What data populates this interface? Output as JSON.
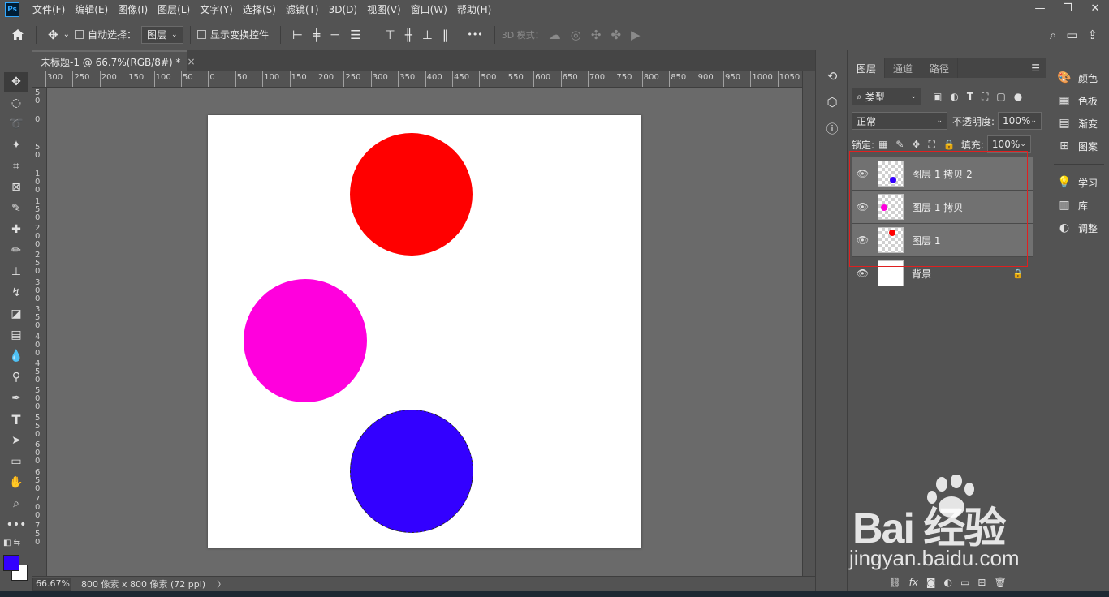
{
  "app": {
    "logo": "Ps",
    "menu": [
      "文件(F)",
      "编辑(E)",
      "图像(I)",
      "图层(L)",
      "文字(Y)",
      "选择(S)",
      "滤镜(T)",
      "3D(D)",
      "视图(V)",
      "窗口(W)",
      "帮助(H)"
    ]
  },
  "options_bar": {
    "auto_select_label": "自动选择：",
    "auto_select_value": "图层",
    "show_transform_label": "显示变换控件",
    "more": "•••",
    "mode_3d_label": "3D 模式："
  },
  "document": {
    "tab_title": "未标题-1 @ 66.7%(RGB/8#) *",
    "close": "×",
    "background": "#ffffff",
    "circles": [
      {
        "name": "red-circle",
        "color": "#ff0000"
      },
      {
        "name": "magenta-circle",
        "color": "#ff00dd"
      },
      {
        "name": "blue-circle",
        "color": "#3300ff"
      }
    ]
  },
  "ruler": {
    "top_labels": [
      "300",
      "250",
      "200",
      "150",
      "100",
      "50",
      "0",
      "50",
      "100",
      "150",
      "200",
      "250",
      "300",
      "350",
      "400",
      "450",
      "500",
      "550",
      "600",
      "650",
      "700",
      "750",
      "800",
      "850",
      "900",
      "950",
      "1000",
      "1050"
    ],
    "left_labels": [
      "50",
      "0",
      "50",
      "100",
      "150",
      "200",
      "250",
      "300",
      "350",
      "400",
      "450",
      "500",
      "550",
      "600",
      "650",
      "700",
      "750"
    ]
  },
  "status": {
    "zoom": "66.67%",
    "doc_info": "800 像素 x 800 像素 (72 ppi)",
    "arrow": "〉"
  },
  "colors": {
    "foreground": "#3300ff",
    "background": "#ffffff",
    "selection_box": "#e02020"
  },
  "layers_panel": {
    "tabs": [
      "图层",
      "通道",
      "路径"
    ],
    "filter_kind": "类型",
    "blend_mode": "正常",
    "opacity_label": "不透明度:",
    "opacity_value": "100%",
    "lock_label": "锁定:",
    "fill_label": "填充:",
    "fill_value": "100%",
    "layers": [
      {
        "name": "图层 1 拷贝 2",
        "dot_color": "#3300ff",
        "selected": true
      },
      {
        "name": "图层 1 拷贝",
        "dot_color": "#ff00dd",
        "selected": true
      },
      {
        "name": "图层 1",
        "dot_color": "#ff0000",
        "selected": true
      },
      {
        "name": "背景",
        "dot_color": "",
        "selected": false
      }
    ]
  },
  "mini_panel": {
    "items": [
      {
        "icon": "palette-icon",
        "label": "颜色"
      },
      {
        "icon": "swatches-icon",
        "label": "色板"
      },
      {
        "icon": "gradient-icon",
        "label": "渐变"
      },
      {
        "icon": "pattern-icon",
        "label": "图案"
      },
      {
        "icon": "lightbulb-icon",
        "label": "学习"
      },
      {
        "icon": "library-icon",
        "label": "库"
      },
      {
        "icon": "adjustments-icon",
        "label": "调整"
      }
    ]
  },
  "watermark": {
    "brand": "Bai  经验",
    "url": "jingyan.baidu.com"
  }
}
